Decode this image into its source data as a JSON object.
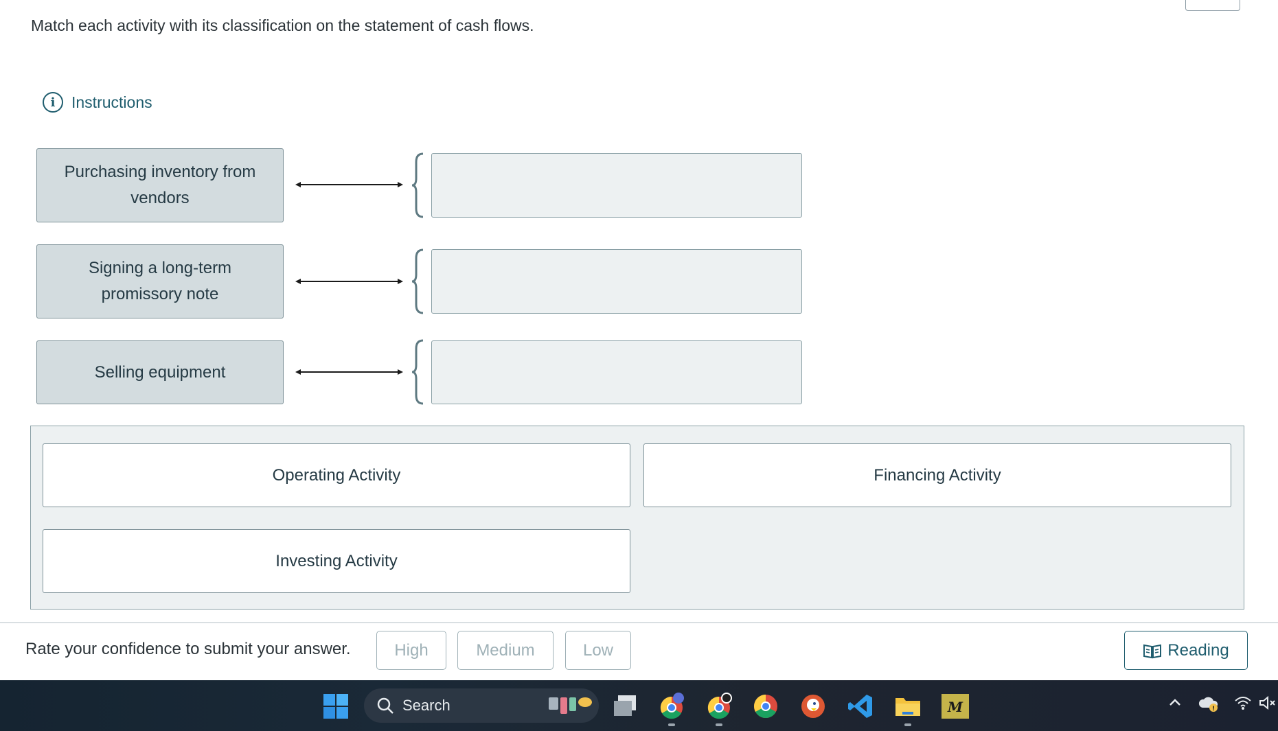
{
  "prompt": "Match each activity with its classification on the statement of cash flows.",
  "instructions_label": "Instructions",
  "activities": [
    {
      "label": "Purchasing inventory from vendors"
    },
    {
      "label": "Signing a long-term promissory note"
    },
    {
      "label": "Selling equipment"
    }
  ],
  "options": [
    {
      "label": "Operating Activity"
    },
    {
      "label": "Financing Activity"
    },
    {
      "label": "Investing Activity"
    }
  ],
  "confidence": {
    "label": "Rate your confidence to submit your answer.",
    "high": "High",
    "medium": "Medium",
    "low": "Low"
  },
  "reading_label": "Reading",
  "taskbar": {
    "search_label": "Search",
    "icons": [
      "windows-start-icon",
      "search-icon",
      "task-view-icon",
      "chrome-profile-icon",
      "chrome-icon",
      "chrome-icon",
      "duckduckgo-icon",
      "vscode-icon",
      "file-explorer-icon",
      "mcgraw-hill-icon",
      "chevron-up-icon",
      "onedrive-warning-icon",
      "wifi-icon",
      "volume-muted-icon"
    ]
  },
  "colors": {
    "accent": "#1f5d6e",
    "activity_fill": "#d3dcdf",
    "zone_fill": "#edf1f2",
    "disabled_text": "#9fb1b7"
  }
}
